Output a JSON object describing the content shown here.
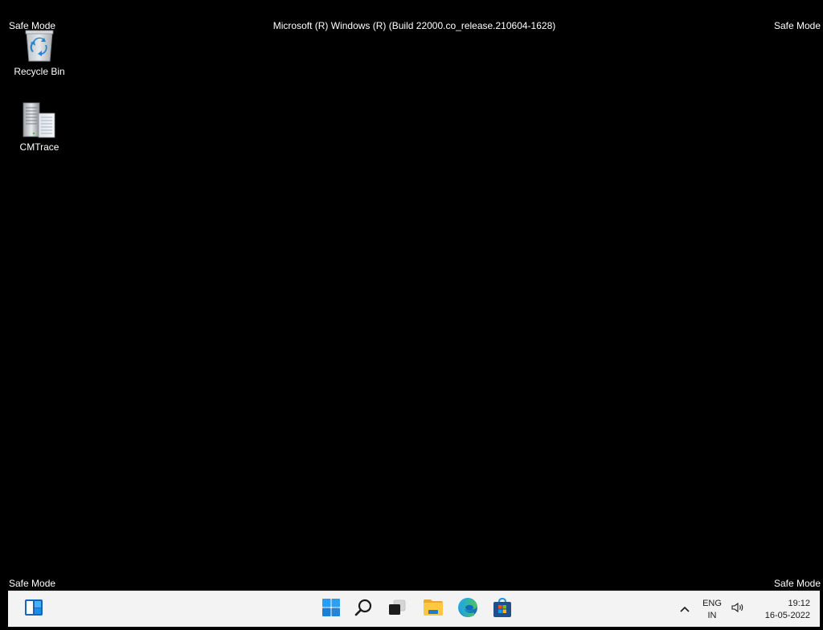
{
  "watermarks": {
    "top_left": "Safe Mode",
    "top_right": "Safe Mode",
    "bottom_left": "Safe Mode",
    "bottom_right": "Safe Mode",
    "build": "Microsoft (R) Windows (R) (Build 22000.co_release.210604-1628)"
  },
  "desktop": {
    "background_color": "#000000",
    "icons": [
      {
        "label": "Recycle Bin",
        "icon": "recycle-bin-icon"
      },
      {
        "label": "CMTrace",
        "icon": "cmtrace-icon"
      }
    ]
  },
  "taskbar": {
    "background_color": "#f3f3f3",
    "buttons": [
      {
        "name": "widgets",
        "icon": "widgets-icon"
      },
      {
        "name": "start",
        "icon": "windows-start-icon"
      },
      {
        "name": "search",
        "icon": "search-icon"
      },
      {
        "name": "task-view",
        "icon": "task-view-icon"
      },
      {
        "name": "file-explorer",
        "icon": "folder-icon"
      },
      {
        "name": "edge",
        "icon": "edge-browser-icon"
      },
      {
        "name": "store",
        "icon": "store-bag-icon"
      }
    ],
    "tray": {
      "overflow_icon": "chevron-up-icon",
      "language_line1": "ENG",
      "language_line2": "IN",
      "volume_icon": "speaker-icon",
      "time": "19:12",
      "date": "16-05-2022"
    }
  }
}
